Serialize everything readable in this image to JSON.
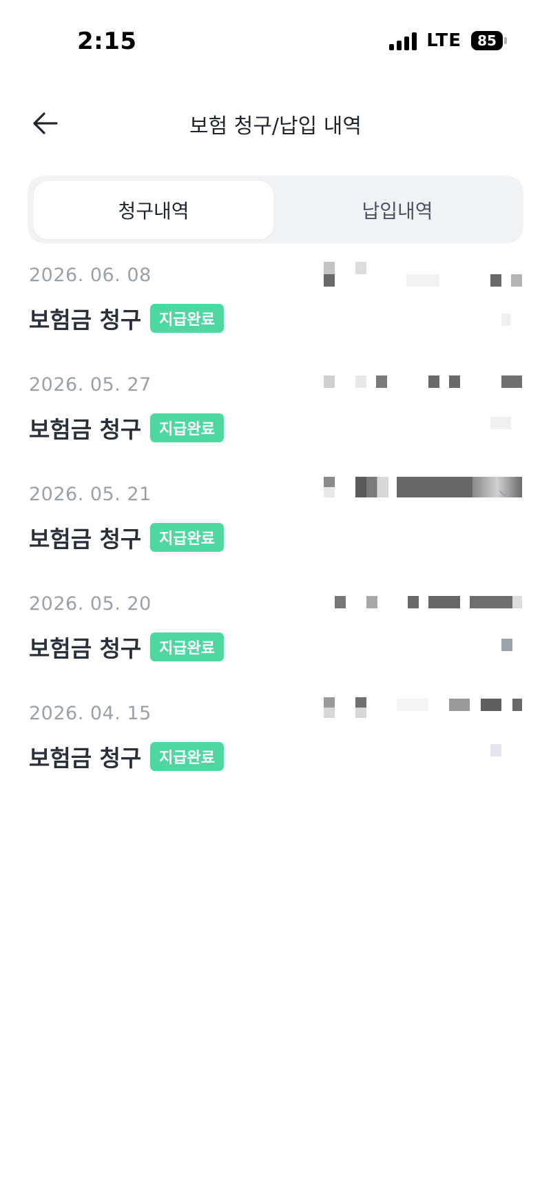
{
  "status": {
    "time": "2:15",
    "network": "LTE",
    "battery": "85"
  },
  "header": {
    "title": "보험 청구/납입 내역"
  },
  "tabs": [
    {
      "label": "청구내역",
      "active": true
    },
    {
      "label": "납입내역",
      "active": false
    }
  ],
  "claims": [
    {
      "date": "2026. 06. 08",
      "title": "보험금 청구",
      "status": "지급완료"
    },
    {
      "date": "2026. 05. 27",
      "title": "보험금 청구",
      "status": "지급완료"
    },
    {
      "date": "2026. 05. 21",
      "title": "보험금 청구",
      "status": "지급완료"
    },
    {
      "date": "2026. 05. 20",
      "title": "보험금 청구",
      "status": "지급완료"
    },
    {
      "date": "2026. 04. 15",
      "title": "보험금 청구",
      "status": "지급완료"
    }
  ],
  "colors": {
    "badge": "#4fd7a2",
    "date": "#9a9fa8",
    "tabBackground": "#f1f2f4"
  },
  "icons": {
    "back": "arrow-left-icon",
    "expand": "chevron-down-icon"
  }
}
